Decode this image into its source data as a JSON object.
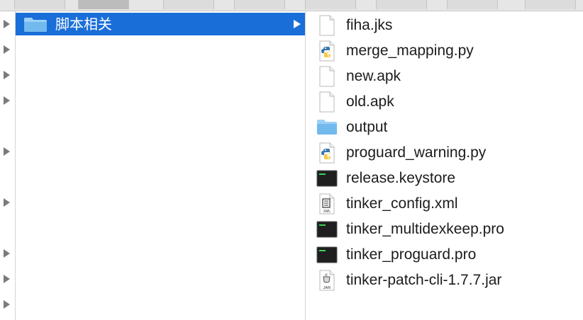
{
  "selected_folder": {
    "name": "脚本相关",
    "icon": "folder-icon"
  },
  "files": [
    {
      "name": "fiha.jks",
      "icon": "blank-document-icon"
    },
    {
      "name": "merge_mapping.py",
      "icon": "python-file-icon"
    },
    {
      "name": "new.apk",
      "icon": "blank-document-icon"
    },
    {
      "name": "old.apk",
      "icon": "blank-document-icon"
    },
    {
      "name": "output",
      "icon": "folder-icon"
    },
    {
      "name": "proguard_warning.py",
      "icon": "python-file-icon"
    },
    {
      "name": "release.keystore",
      "icon": "terminal-file-icon"
    },
    {
      "name": "tinker_config.xml",
      "icon": "xml-file-icon"
    },
    {
      "name": "tinker_multidexkeep.pro",
      "icon": "terminal-file-icon"
    },
    {
      "name": "tinker_proguard.pro",
      "icon": "terminal-file-icon"
    },
    {
      "name": "tinker-patch-cli-1.7.7.jar",
      "icon": "jar-file-icon"
    }
  ],
  "icon_labels": {
    "xml": "XML",
    "jar": "JAR"
  },
  "colors": {
    "selection": "#1a6ed8",
    "folder": "#6cb4ee",
    "terminal": "#2a2a2a"
  }
}
